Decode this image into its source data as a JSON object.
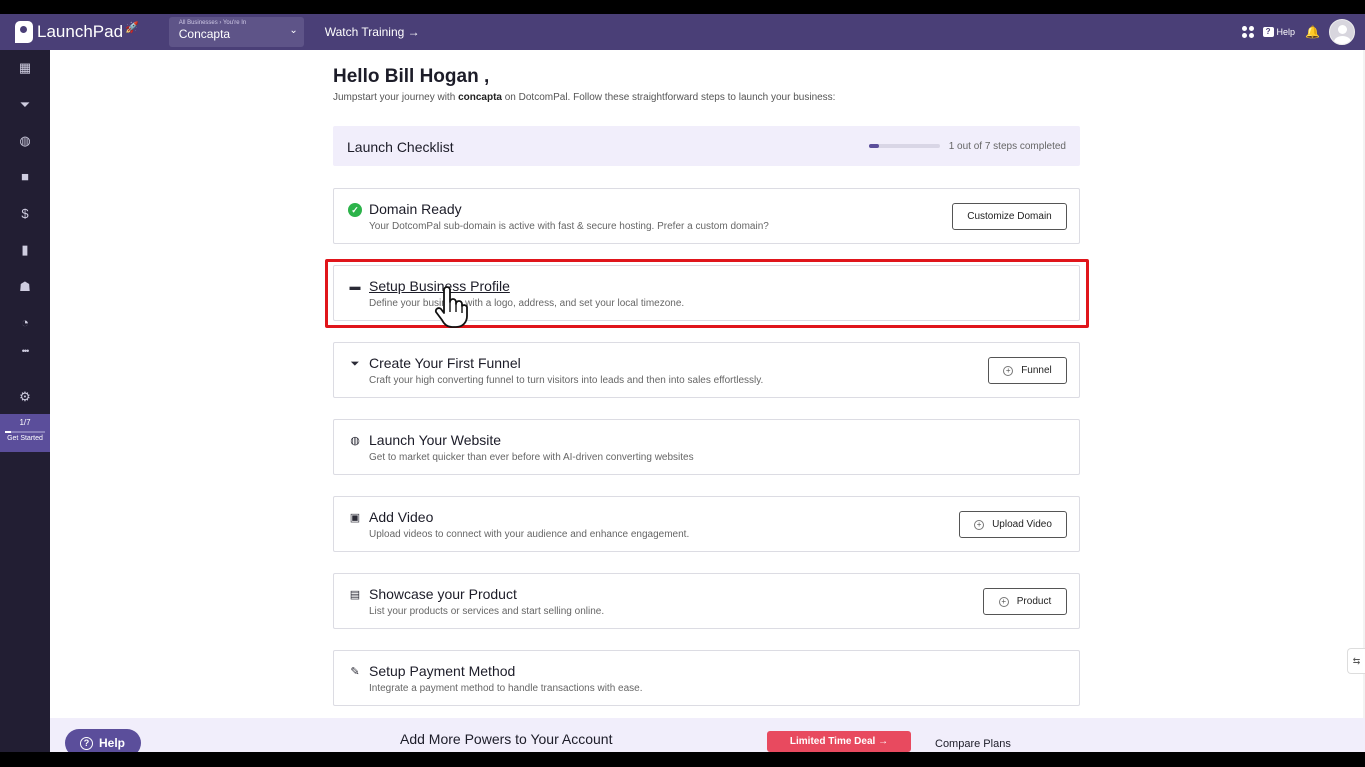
{
  "header": {
    "app_name": "LaunchPad",
    "logo_rocket": "🚀",
    "business_crumb": "All Businesses › You're In",
    "business_name": "Concapta",
    "business_chevron": "⌄",
    "watch_training": "Watch Training →",
    "help_label": "Help",
    "help_icon_glyph": "?",
    "bell_glyph": "🔔"
  },
  "sidebar": {
    "icons": [
      {
        "name": "dashboard-icon",
        "glyph": "▦"
      },
      {
        "name": "funnel-icon",
        "glyph": "⏷"
      },
      {
        "name": "globe-icon",
        "glyph": "◍"
      },
      {
        "name": "video-icon",
        "glyph": "■"
      },
      {
        "name": "dollar-icon",
        "glyph": "$"
      },
      {
        "name": "analytics-icon",
        "glyph": "▮"
      },
      {
        "name": "contacts-icon",
        "glyph": "☗"
      },
      {
        "name": "history-icon",
        "glyph": "◔"
      },
      {
        "name": "more-icon",
        "glyph": "•••"
      },
      {
        "name": "settings-icon",
        "glyph": "⚙"
      }
    ],
    "progress_count": "1/7",
    "progress_fraction": 0.14,
    "get_started_label": "Get Started"
  },
  "main": {
    "greeting": "Hello Bill Hogan ,",
    "subtitle_prefix": "Jumpstart your journey with ",
    "subtitle_business": "concapta",
    "subtitle_suffix": " on DotcomPal. Follow these straightforward steps to launch your business:",
    "checklist_title": "Launch Checklist",
    "checklist_progress_fraction": 0.14,
    "checklist_steps_text": "1 out of 7 steps completed"
  },
  "steps": [
    {
      "title": "Domain Ready",
      "desc": "Your DotcomPal sub-domain is active with fast & secure hosting. Prefer a custom domain?",
      "button": "Customize Domain",
      "icon_glyph": "✓",
      "done": true
    },
    {
      "title": "Setup Business Profile",
      "desc": "Define your business with a logo, address, and set your local timezone.",
      "icon_glyph": "▬"
    },
    {
      "title": "Create Your First Funnel",
      "desc": "Craft your high converting funnel to turn visitors into leads and then into sales effortlessly.",
      "button": "Funnel",
      "icon_glyph": "⏷"
    },
    {
      "title": "Launch Your Website",
      "desc": "Get to market quicker than ever before with AI-driven converting websites",
      "icon_glyph": "◍"
    },
    {
      "title": "Add Video",
      "desc": "Upload videos to connect with your audience and enhance engagement.",
      "button": "Upload Video",
      "icon_glyph": "▣"
    },
    {
      "title": "Showcase your Product",
      "desc": "List your products or services and start selling online.",
      "button": "Product",
      "icon_glyph": "▤"
    },
    {
      "title": "Setup Payment Method",
      "desc": "Integrate a payment method to handle transactions with ease.",
      "icon_glyph": "✎"
    }
  ],
  "plus_glyph": "+",
  "promo": {
    "title": "Add More Powers to Your Account",
    "deal_button": "Limited Time Deal →",
    "compare_link": "Compare Plans"
  },
  "help_button": "Help",
  "help_button_glyph": "?",
  "edge_tab_glyph": "⇆",
  "colors": {
    "topbar": "#4a3f77",
    "sidebar": "#221e33",
    "accent": "#5b4e9b",
    "highlight": "#e0151b",
    "success": "#2cb34a",
    "deal": "#e84a5f"
  }
}
